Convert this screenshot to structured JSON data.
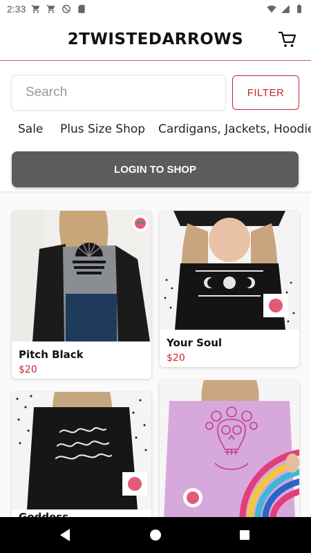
{
  "status_bar": {
    "time": "2:33",
    "left_icons": [
      "cart-icon",
      "cart-icon",
      "do-not-disturb-icon",
      "sd-card-icon"
    ],
    "right_icons": [
      "wifi-icon",
      "signal-icon",
      "battery-icon"
    ]
  },
  "header": {
    "title": "2TWISTEDARROWS",
    "cart_icon": "cart-icon",
    "accent_color": "#d9535f"
  },
  "search": {
    "placeholder": "Search",
    "value": "",
    "filter_label": "FILTER",
    "filter_color": "#c9242f"
  },
  "categories": [
    "Sale",
    "Plus Size Shop",
    "Cardigans, Jackets, Hoodies"
  ],
  "login": {
    "label": "LOGIN TO SHOP",
    "color": "#5c5c5c"
  },
  "products": [
    {
      "name": "Pitch Black",
      "price": "$20",
      "shirt_color": "#8a8d92",
      "print": "WELL AREN'T YOU A LITTLE RAY OF PITCH BLACK"
    },
    {
      "name": "Your Soul",
      "price": "$20",
      "shirt_color": "#141414",
      "print": "THE SUN SEES YOUR BODY THE MOON SEES YOUR SOUL"
    },
    {
      "name": "Goddess",
      "price": "",
      "shirt_color": "#161616",
      "print": "goddess. badass. woman."
    },
    {
      "name": "",
      "price": "",
      "shirt_color": "#d7a8dc",
      "print": ""
    }
  ],
  "nav": {
    "back_icon": "back-triangle-icon",
    "home_icon": "home-circle-icon",
    "recents_icon": "recents-square-icon"
  }
}
